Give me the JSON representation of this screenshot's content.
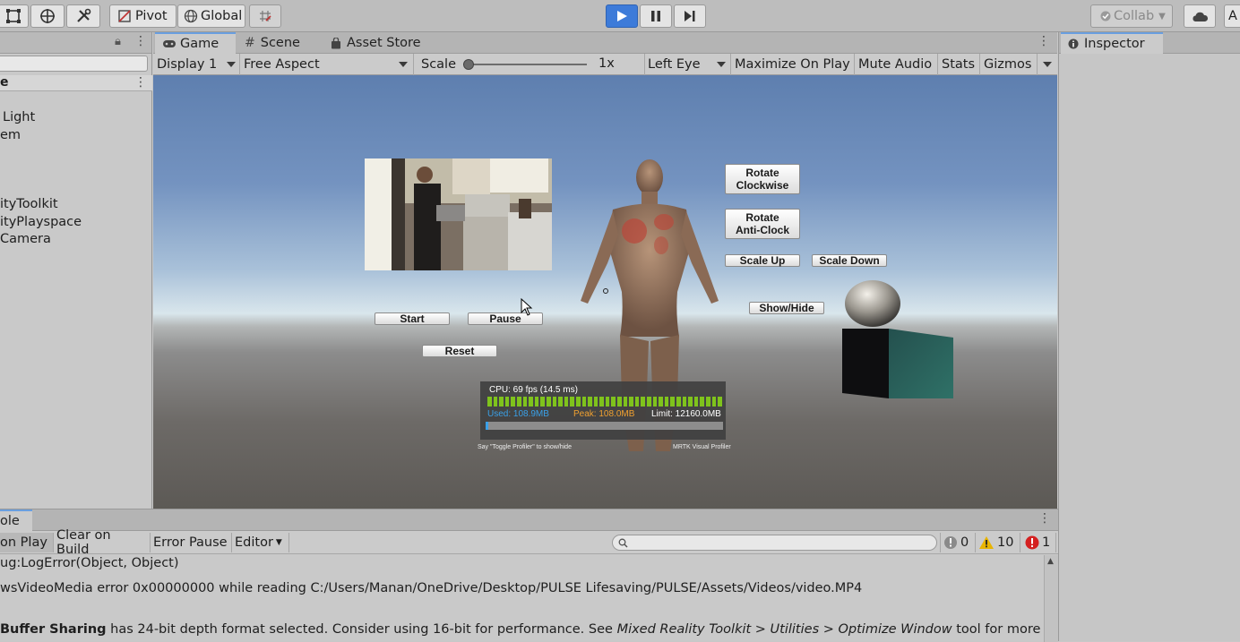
{
  "toolbar": {
    "pivot": "Pivot",
    "global": "Global",
    "collab": "Collab",
    "account": "A"
  },
  "hierarchy": {
    "items": [
      "Light",
      "em",
      "ityToolkit",
      "ityPlayspace",
      "Camera"
    ],
    "scene_label": "e"
  },
  "game": {
    "tabs": [
      "Game",
      "Scene",
      "Asset Store"
    ],
    "display": "Display 1",
    "aspect": "Free Aspect",
    "scale_label": "Scale",
    "scale_value": "1x",
    "scale_fraction": 0.0,
    "eye": "Left Eye",
    "maximize": "Maximize On Play",
    "mute": "Mute Audio",
    "stats": "Stats",
    "gizmos": "Gizmos"
  },
  "scene_buttons": {
    "rotate_cw": [
      "Rotate",
      "Clockwise"
    ],
    "rotate_acw": [
      "Rotate",
      "Anti-Clock"
    ],
    "scale_up": "Scale Up",
    "scale_down": "Scale Down",
    "show_hide": "Show/Hide",
    "start": "Start",
    "pause": "Pause",
    "reset": "Reset"
  },
  "profiler": {
    "cpu": "CPU: 69 fps (14.5 ms)",
    "used": "Used: 108.9MB",
    "peak": "Peak: 108.0MB",
    "limit": "Limit: 12160.0MB",
    "memory_fraction": 0.01,
    "hint_left": "Say \"Toggle Profiler\" to show/hide",
    "hint_right": "MRTK Visual Profiler"
  },
  "inspector": {
    "title": "Inspector"
  },
  "console": {
    "tab": "ole",
    "clear_on_play": "on Play",
    "clear_on_build": "Clear on Build",
    "error_pause": "Error Pause",
    "editor": "Editor",
    "info_count": "0",
    "warn_count": "10",
    "error_count": "1",
    "lines": [
      "ug:LogError(Object, Object)",
      "wsVideoMedia error 0x00000000 while reading C:/Users/Manan/OneDrive/Desktop/PULSE Lifesaving/PULSE/Assets/Videos/video.MP4",
      "Buffer Sharing",
      " has 24-bit depth format selected. Consider using 16-bit for performance. See ",
      "Mixed Reality Toolkit > Utilities > Optimize Window",
      " tool for more informatic"
    ]
  },
  "colors": {
    "play_active": "#3d7bd9",
    "profiler_bar": "#7fc31c",
    "used_text": "#3aa0e8",
    "peak_text": "#f0a030",
    "warning": "#e8b400",
    "error": "#d42020"
  }
}
